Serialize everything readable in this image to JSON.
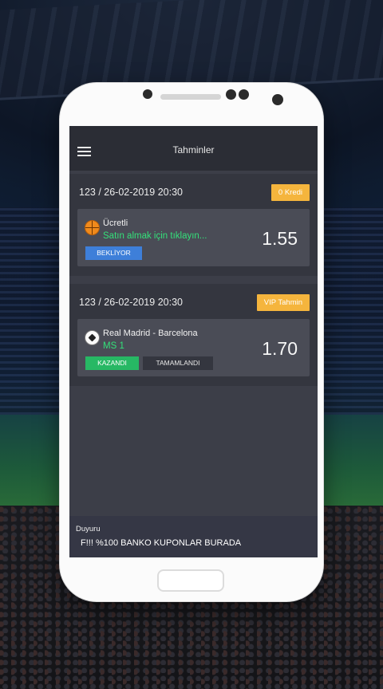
{
  "app": {
    "title": "Tahminler"
  },
  "predictions": [
    {
      "date": "123 / 26-02-2019 20:30",
      "tag": "0 Kredi",
      "sport_icon": "basketball-icon",
      "line1": "Ücretli",
      "line2": "Satın almak için tıklayın...",
      "odds": "1.55",
      "status": "BEKLİYOR"
    },
    {
      "date": "123 / 26-02-2019 20:30",
      "tag": "VIP Tahmin",
      "sport_icon": "soccer-ball-icon",
      "line1": "Real Madrid - Barcelona",
      "line2": "MS 1",
      "odds": "1.70",
      "status": "KAZANDI",
      "status2": "TAMAMLANDI"
    }
  ],
  "announcement": {
    "label": "Duyuru",
    "text": "F!!! %100 BANKO KUPONLAR BURADA"
  },
  "colors": {
    "accent_tag": "#f5b53d",
    "pending": "#3e7fd9",
    "won": "#27b864",
    "highlight_text": "#34e07a"
  }
}
